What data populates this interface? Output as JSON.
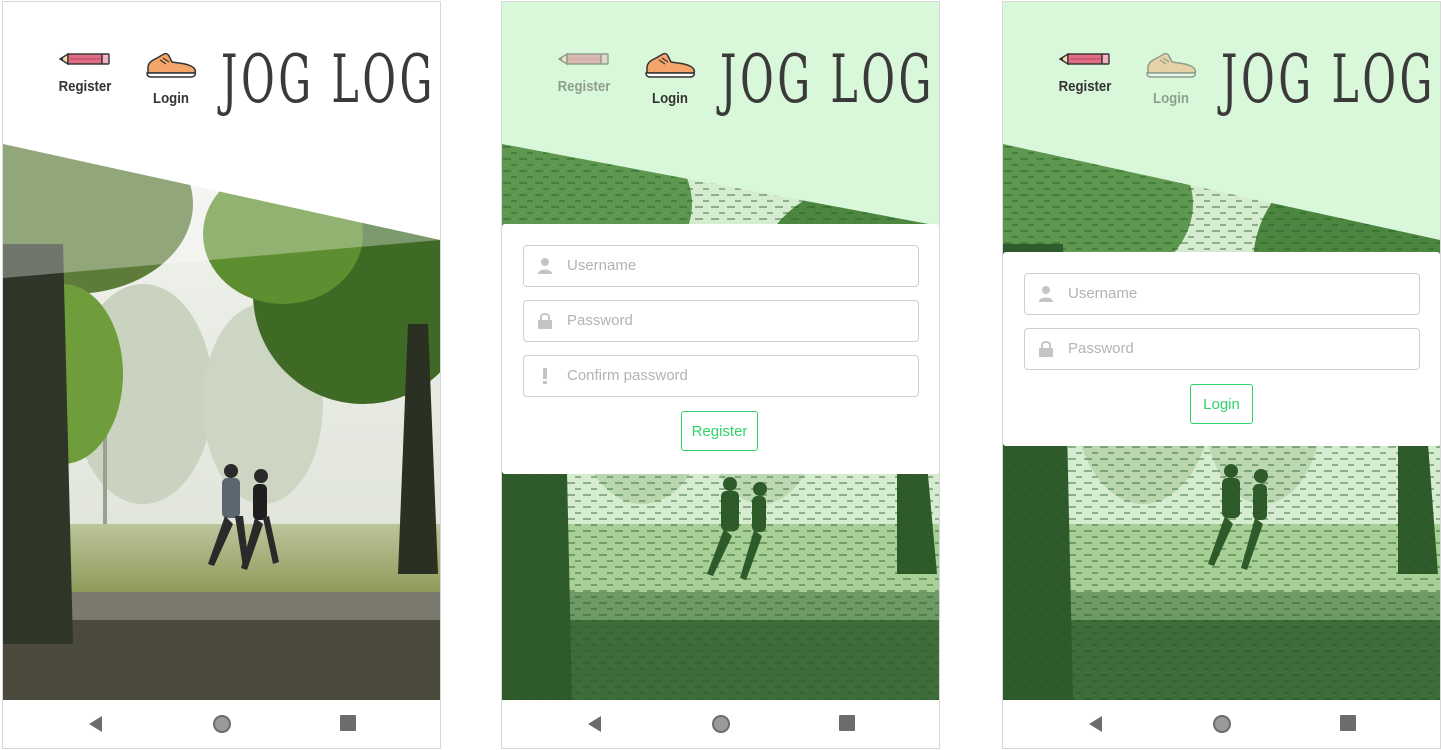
{
  "app": {
    "logo_text": "JOG LOG",
    "nav": {
      "register_label": "Register",
      "login_label": "Login"
    },
    "icons": {
      "register": "pencil-icon",
      "login": "running-shoe-icon",
      "username": "user-icon",
      "password": "lock-icon",
      "confirm": "exclamation-icon"
    }
  },
  "register_form": {
    "username_placeholder": "Username",
    "password_placeholder": "Password",
    "confirm_placeholder": "Confirm password",
    "submit_label": "Register"
  },
  "login_form": {
    "username_placeholder": "Username",
    "password_placeholder": "Password",
    "submit_label": "Login"
  },
  "colors": {
    "accent": "#2fd36a",
    "header_tint": "#d9f7d9",
    "pencil": "#e06c86",
    "shoe": "#f4a66a",
    "text": "#333333"
  }
}
